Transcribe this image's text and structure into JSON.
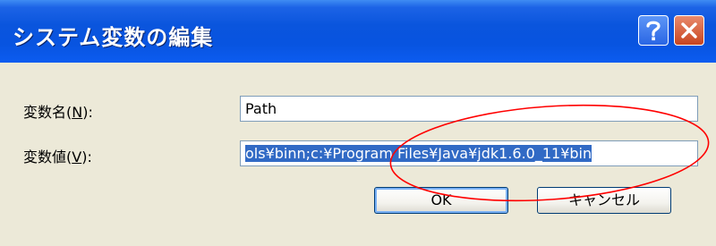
{
  "dialog": {
    "title": "システム変数の編集",
    "help_icon": "question-mark",
    "close_icon": "x-mark"
  },
  "fields": {
    "name_label_prefix": "変数名(",
    "name_label_key": "N",
    "name_label_suffix": "):",
    "name_value": "Path",
    "value_label_prefix": "変数値(",
    "value_label_key": "V",
    "value_label_suffix": "):",
    "value_value": "ols¥binn;c:¥Program Files¥Java¥jdk1.6.0_11¥bin"
  },
  "buttons": {
    "ok": "OK",
    "cancel": "キャンセル"
  },
  "colors": {
    "annotation_circle": "#ff0000",
    "selection": "#316ac5"
  }
}
